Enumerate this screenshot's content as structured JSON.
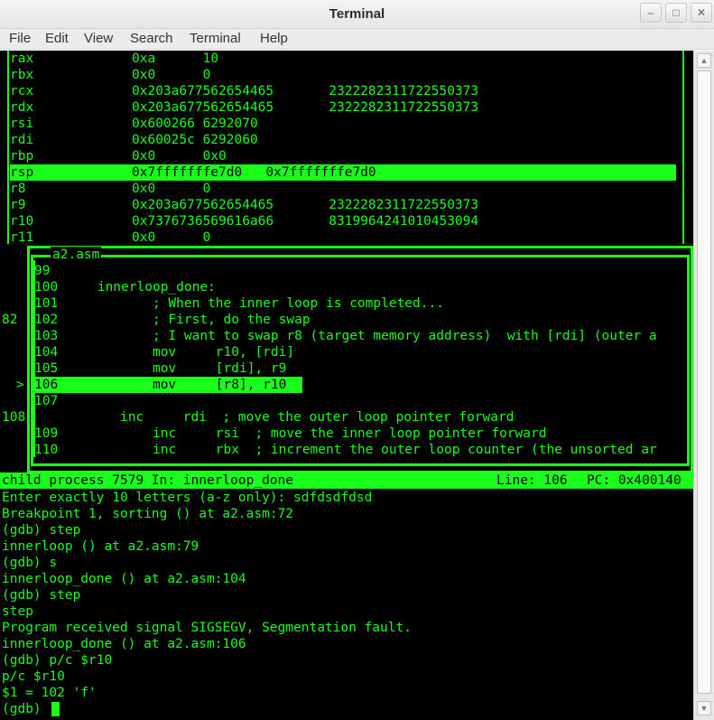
{
  "window": {
    "title": "Terminal"
  },
  "menu": [
    "File",
    "Edit",
    "View",
    "Search",
    "Terminal",
    "Help"
  ],
  "registers": [
    {
      "name": "rax",
      "hex": "0xa",
      "val": "10",
      "sep": "      "
    },
    {
      "name": "rbx",
      "hex": "0x0",
      "val": "0",
      "sep": "      "
    },
    {
      "name": "rcx",
      "hex": "0x203a677562654465",
      "val": "2322282311722550373",
      "sep": "       "
    },
    {
      "name": "rdx",
      "hex": "0x203a677562654465",
      "val": "2322282311722550373",
      "sep": "       "
    },
    {
      "name": "rsi",
      "hex": "0x600266",
      "val": "6292070",
      "sep": " "
    },
    {
      "name": "rdi",
      "hex": "0x60025c",
      "val": "6292060",
      "sep": " "
    },
    {
      "name": "rbp",
      "hex": "0x0",
      "val": "0x0",
      "sep": "      "
    },
    {
      "name": "rsp",
      "hex": "0x7fffffffe7d0",
      "val": "0x7fffffffe7d0",
      "sep": "   "
    },
    {
      "name": "r8",
      "hex": "0x0",
      "val": "0",
      "sep": "      "
    },
    {
      "name": "r9",
      "hex": "0x203a677562654465",
      "val": "2322282311722550373",
      "sep": "       "
    },
    {
      "name": "r10",
      "hex": "0x7376736569616a66",
      "val": "8319964241010453094",
      "sep": "       "
    },
    {
      "name": "r11",
      "hex": "0x0",
      "val": "0",
      "sep": "      "
    }
  ],
  "source": {
    "title": "a2.asm",
    "lines": [
      {
        "no": "99",
        "code": ""
      },
      {
        "no": "100",
        "code": "    innerloop_done:"
      },
      {
        "no": "101",
        "code": "            ; When the inner loop is completed..."
      },
      {
        "no": "102",
        "code": "            ; First, do the swap"
      },
      {
        "no": "103",
        "code": "            ; I want to swap r8 (target memory address)  with [rdi] (outer a"
      },
      {
        "no": "104",
        "code": "            mov     r10, [rdi]"
      },
      {
        "no": "105",
        "code": "            mov     [rdi], r9"
      },
      {
        "no": "106",
        "code": "            mov     [r8], r10"
      },
      {
        "no": "107",
        "code": ""
      },
      {
        "no": "108",
        "code": "            inc     rdi  ; move the outer loop pointer forward"
      },
      {
        "no": "109",
        "code": "            inc     rsi  ; move the inner loop pointer forward"
      },
      {
        "no": "110",
        "code": "            inc     rbx  ; increment the outer loop counter (the unsorted ar"
      }
    ],
    "left_marker_82": "82",
    "arrow": ">"
  },
  "status": {
    "left": "child process 7579 In: innerloop_done",
    "line": "Line: 106",
    "pc": "PC: 0x400140"
  },
  "console": [
    "Enter exactly 10 letters (a-z only): sdfdsdfdsd",
    "Breakpoint 1, sorting () at a2.asm:72",
    "(gdb) step",
    "innerloop () at a2.asm:79",
    "(gdb) s",
    "innerloop_done () at a2.asm:104",
    "(gdb) step",
    "step",
    "Program received signal SIGSEGV, Segmentation fault.",
    "innerloop_done () at a2.asm:106",
    "(gdb) p/c $r10",
    "p/c $r10",
    "$1 = 102 'f'",
    "(gdb) "
  ],
  "colors": {
    "fg": "#19ff19",
    "bg": "#000000"
  }
}
